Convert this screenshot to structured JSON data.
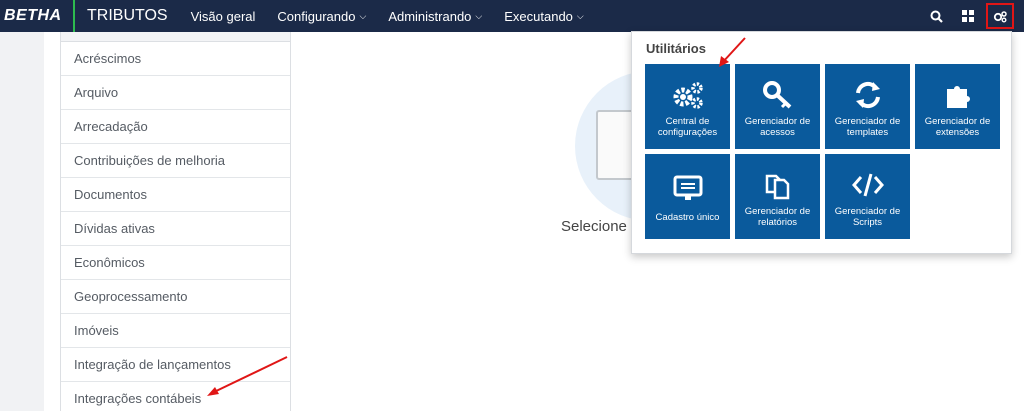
{
  "navbar": {
    "brand": "BETHA",
    "app_name": "TRIBUTOS",
    "items": [
      {
        "label": "Visão geral"
      },
      {
        "label": "Configurando"
      },
      {
        "label": "Administrando"
      },
      {
        "label": "Executando"
      }
    ]
  },
  "sidebar": {
    "items": [
      {
        "label": "Acréscimos"
      },
      {
        "label": "Arquivo"
      },
      {
        "label": "Arrecadação"
      },
      {
        "label": "Contribuições de melhoria"
      },
      {
        "label": "Documentos"
      },
      {
        "label": "Dívidas ativas"
      },
      {
        "label": "Econômicos"
      },
      {
        "label": "Geoprocessamento"
      },
      {
        "label": "Imóveis"
      },
      {
        "label": "Integração de lançamentos"
      },
      {
        "label": "Integrações contábeis"
      }
    ]
  },
  "main": {
    "empty_text": "Selecione"
  },
  "utilities": {
    "title": "Utilitários",
    "tiles": [
      {
        "label": "Central de configurações",
        "icon": "gears-icon"
      },
      {
        "label": "Gerenciador de acessos",
        "icon": "key-icon"
      },
      {
        "label": "Gerenciador de templates",
        "icon": "refresh-icon"
      },
      {
        "label": "Gerenciador de extensões",
        "icon": "puzzle-icon"
      },
      {
        "label": "Cadastro único",
        "icon": "monitor-icon"
      },
      {
        "label": "Gerenciador de relatórios",
        "icon": "documents-icon"
      },
      {
        "label": "Gerenciador de Scripts",
        "icon": "code-icon"
      }
    ]
  },
  "colors": {
    "navbar": "#1b2a48",
    "tile": "#0a5a9c",
    "brand_accent": "#2dbb4f",
    "annotation": "#e01616"
  }
}
